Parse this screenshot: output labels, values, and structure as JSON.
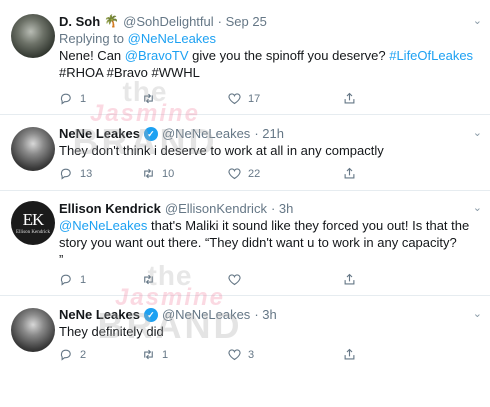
{
  "colors": {
    "link": "#1da1f2",
    "muted": "#657786",
    "text": "#14171a",
    "divider": "#e6ecf0"
  },
  "watermark": {
    "line1": "the",
    "line2": "Jasmine",
    "line3": "BRAND"
  },
  "tweets": [
    {
      "name": "D. Soh",
      "emoji": "🌴",
      "handle": "@SohDelightful",
      "time": "· Sep 25",
      "replying_prefix": "Replying to",
      "replying_handle": "@NeNeLeakes",
      "text_parts": [
        "Nene! Can ",
        "@BravoTV",
        " give you the spinoff you deserve? ",
        "#LifeOfLeakes"
      ],
      "text_line2": "#RHOA #Bravo #WWHL",
      "reply_count": "1",
      "retweet_count": "",
      "like_count": "17",
      "avatar_icon": "user-avatar-photo"
    },
    {
      "name": "NeNe Leakes",
      "handle": "@NeNeLeakes",
      "time": "· 21h",
      "text": "They don't think i deserve to work at all in any compactly",
      "reply_count": "13",
      "retweet_count": "10",
      "like_count": "22",
      "avatar_icon": "nene-avatar-photo"
    },
    {
      "name": "Ellison Kendrick",
      "handle": "@EllisonKendrick",
      "time": "· 3h",
      "text_mention": "@NeNeLeakes",
      "text_line1": " that's Maliki it sound like they forced you out! Is that the",
      "text_line2": "story you want out there.  “They didn't want u to work in any capacity?",
      "text_line3": "”",
      "avatar_mark": "EK",
      "avatar_sub": "Ellison Kendrick",
      "reply_count": "1",
      "retweet_count": "",
      "like_count": ""
    },
    {
      "name": "NeNe Leakes",
      "handle": "@NeNeLeakes",
      "time": "· 3h",
      "text": "They definitely did",
      "reply_count": "2",
      "retweet_count": "1",
      "like_count": "3",
      "avatar_icon": "nene-avatar-photo"
    }
  ]
}
